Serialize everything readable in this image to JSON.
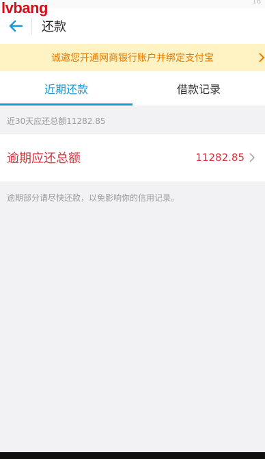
{
  "watermark": "lvbang",
  "status_bar": {
    "text": "16"
  },
  "header": {
    "title": "还款"
  },
  "notice": {
    "text": "诚邀您开通网商银行账户并绑定支付宝"
  },
  "tabs": [
    {
      "label": "近期还款",
      "active": true
    },
    {
      "label": "借款记录",
      "active": false
    }
  ],
  "summary": {
    "text": "近30天应还总额11282.85"
  },
  "overdue": {
    "label": "逾期应还总额",
    "amount": "11282.85"
  },
  "hint": {
    "text": "逾期部分请尽快还款，以免影响你的信用记录。"
  },
  "colors": {
    "accent": "#1a98d5",
    "alert": "#d3333b",
    "notice_bg": "#fff3c4",
    "notice_text": "#e67a00"
  }
}
